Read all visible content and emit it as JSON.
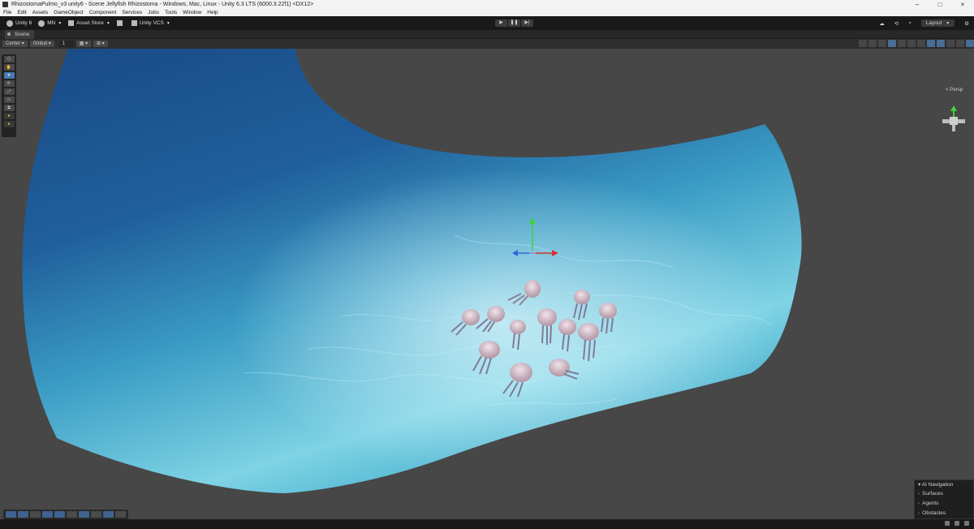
{
  "window": {
    "title": "RhizostomaPulmo_v3 unity6 - Scene Jellyfish Rhizostoma - Windows, Mac, Linux - Unity 6.3 LTS (6000.3.22f1) <DX12>",
    "controls": [
      "–",
      "□",
      "×"
    ]
  },
  "menu": [
    "File",
    "Edit",
    "Assets",
    "GameObject",
    "Component",
    "Services",
    "Jobs",
    "Tools",
    "Window",
    "Help"
  ],
  "toolbar": {
    "unity_label": "Unity 6",
    "account_label": "MN",
    "asset_store_label": "Asset Store",
    "vcs_label": "Unity VCS",
    "play_icons": [
      "▶",
      "❚❚",
      "▶|"
    ],
    "layout_label": "Layout"
  },
  "tabs": {
    "scene_label": "Scene"
  },
  "scene_options": {
    "pivot_label": "Center",
    "space_label": "Global",
    "grid_value": "1"
  },
  "viewport": {
    "camera_label": "< Persp"
  },
  "ai_navigation": {
    "title": "AI Navigation",
    "items": [
      "Surfaces",
      "Agents",
      "Obstacles"
    ]
  },
  "colors": {
    "accent": "#4678b4",
    "water_deep": "#1e4f8a",
    "water_light": "#7fd4e6",
    "gizmo_y": "#3cd23c",
    "gizmo_x": "#d23232",
    "gizmo_z": "#3264dc"
  }
}
